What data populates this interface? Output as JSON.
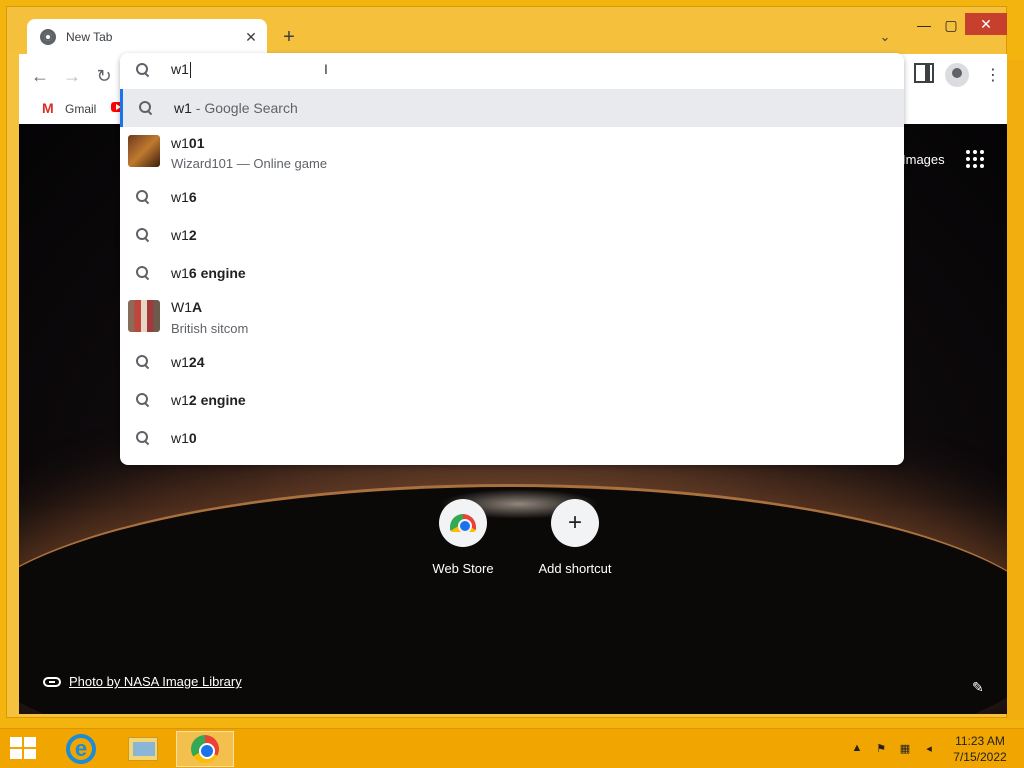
{
  "browser": {
    "tab_title": "New Tab",
    "omnibox_value": "w1",
    "bookmarks": [
      {
        "label": "Gmail"
      }
    ]
  },
  "omnibox": {
    "suggestions": [
      {
        "match": "w1",
        "rest": "",
        "sep": " - Google Search",
        "sub": ""
      },
      {
        "match": "w1",
        "rest": "01",
        "sep": "",
        "sub": "Wizard101 — Online game"
      },
      {
        "match": "w1",
        "rest": "6",
        "sep": "",
        "sub": ""
      },
      {
        "match": "w1",
        "rest": "2",
        "sep": "",
        "sub": ""
      },
      {
        "match": "w1",
        "rest": "6 engine",
        "sep": "",
        "sub": ""
      },
      {
        "match": "W1",
        "rest": "A",
        "sep": "",
        "sub": "British sitcom"
      },
      {
        "match": "w1",
        "rest": "24",
        "sep": "",
        "sub": ""
      },
      {
        "match": "w1",
        "rest": "2 engine",
        "sep": "",
        "sub": ""
      },
      {
        "match": "w1",
        "rest": "0",
        "sep": "",
        "sub": ""
      }
    ]
  },
  "ntp": {
    "images_link": "Images",
    "shortcuts": [
      {
        "label": "Web Store"
      },
      {
        "label": "Add shortcut"
      }
    ],
    "photo_credit": "Photo by NASA Image Library"
  },
  "taskbar": {
    "time": "11:23 AM",
    "date": "7/15/2022"
  }
}
